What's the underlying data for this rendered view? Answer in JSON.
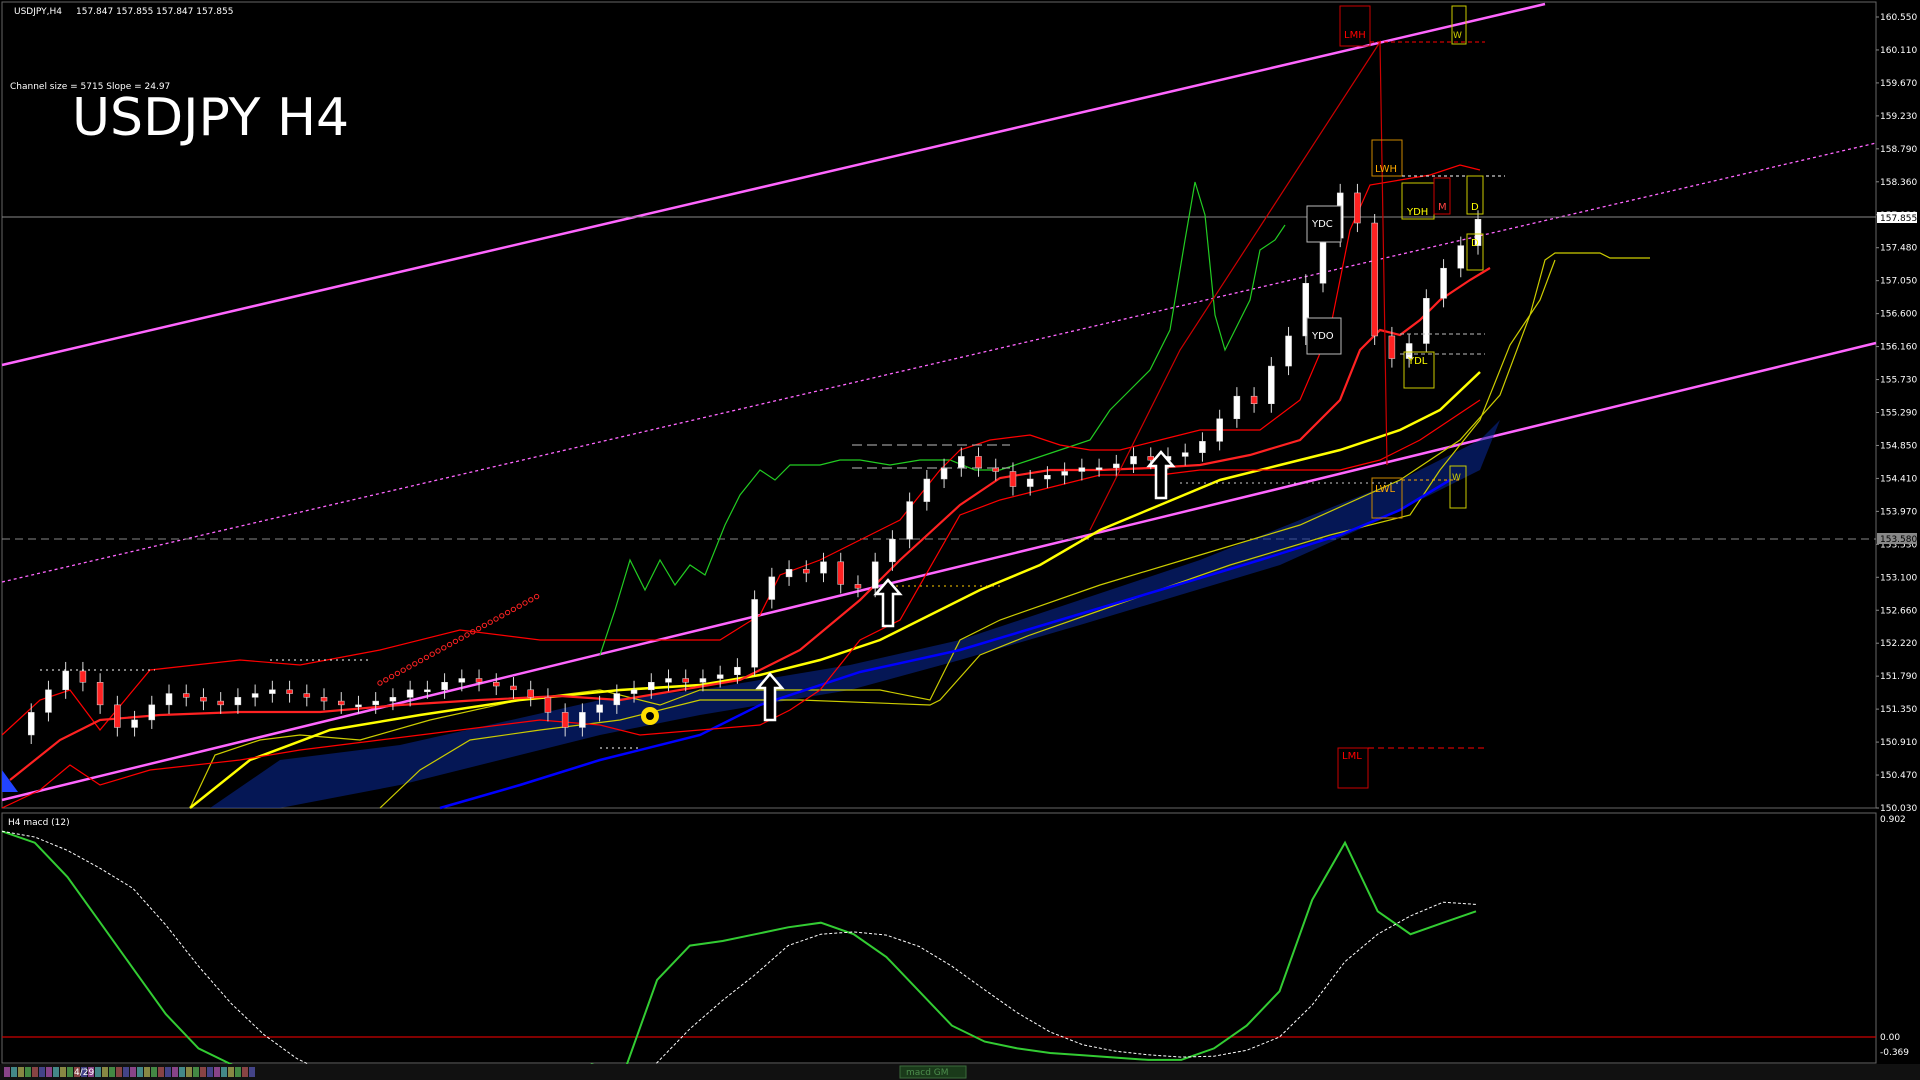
{
  "header": {
    "symbol_info": "USDJPY,H4",
    "ohlc": "157.847 157.855 157.847 157.855"
  },
  "overlay": {
    "channel_info": "Channel size = 5715 Slope = 24.97",
    "big_title": "USDJPY H4"
  },
  "subwindow": {
    "label": "H4 macd (12)"
  },
  "bottom_bar": {
    "date_label": "4/29",
    "tab_label": "macd GM"
  },
  "level_labels": {
    "lmh": "LMH",
    "lml": "LML",
    "lwh": "LWH",
    "lwl": "LWL",
    "ydh": "YDH",
    "ydl": "YDL",
    "ydc": "YDC",
    "ydo": "YDO",
    "w_top": "W",
    "w_bottom": "W",
    "d_top": "D",
    "d_mid": "D",
    "m": "M"
  },
  "colors": {
    "background": "#000000",
    "channel": "#ff66ff",
    "ma_yellow": "#ffff00",
    "ma_blue": "#0000ff",
    "bollinger": "#ff0000",
    "ichimoku_lead": "#00ff00",
    "ichimoku_span": "#cccc00",
    "macd": "#33cc33",
    "signal": "#ffffff",
    "price_line_label": "#ffffff"
  },
  "chart_data": {
    "type": "line",
    "title": "USDJPY H4",
    "price_axis": [
      "160.550",
      "160.110",
      "159.670",
      "159.230",
      "158.790",
      "158.360",
      "157.920",
      "157.480",
      "157.050",
      "156.600",
      "156.160",
      "155.730",
      "155.290",
      "154.850",
      "154.410",
      "153.970",
      "153.530",
      "153.100",
      "152.660",
      "152.220",
      "151.790",
      "151.350",
      "150.910",
      "150.470",
      "150.030"
    ],
    "current_price": "157.855",
    "marked_level": "153.580",
    "macd_axis": [
      "0.902",
      "0.00",
      "-0.369"
    ],
    "macd_zero_label": "0.00",
    "ylim": [
      150.03,
      160.55
    ],
    "close_path": [
      151.0,
      151.3,
      151.6,
      151.85,
      151.7,
      151.4,
      151.1,
      151.2,
      151.4,
      151.55,
      151.5,
      151.45,
      151.4,
      151.5,
      151.55,
      151.6,
      151.55,
      151.5,
      151.45,
      151.4,
      151.4,
      151.45,
      151.5,
      151.6,
      151.6,
      151.7,
      151.75,
      151.7,
      151.65,
      151.6,
      151.5,
      151.3,
      151.1,
      151.3,
      151.4,
      151.55,
      151.6,
      151.7,
      151.75,
      151.7,
      151.75,
      151.8,
      151.9,
      152.8,
      153.1,
      153.2,
      153.15,
      153.3,
      153.0,
      152.95,
      153.3,
      153.6,
      154.1,
      154.4,
      154.55,
      154.7,
      154.55,
      154.5,
      154.3,
      154.4,
      154.45,
      154.5,
      154.55,
      154.55,
      154.6,
      154.7,
      154.65,
      154.7,
      154.75,
      154.9,
      155.2,
      155.5,
      155.4,
      155.9,
      156.3,
      157.0,
      157.6,
      158.2,
      157.8,
      156.3,
      156.0,
      156.2,
      156.8,
      157.2,
      157.5,
      157.85
    ],
    "macd_values": [
      0.9,
      0.85,
      0.7,
      0.5,
      0.3,
      0.1,
      -0.05,
      -0.12,
      -0.18,
      -0.22,
      -0.25,
      -0.26,
      -0.24,
      -0.23,
      -0.24,
      -0.27,
      -0.34,
      -0.2,
      -0.12,
      -0.15,
      0.25,
      0.4,
      0.42,
      0.45,
      0.48,
      0.5,
      0.45,
      0.35,
      0.2,
      0.05,
      -0.02,
      -0.05,
      -0.07,
      -0.08,
      -0.09,
      -0.1,
      -0.1,
      -0.05,
      0.05,
      0.2,
      0.6,
      0.85,
      0.55,
      0.45,
      0.5,
      0.55
    ]
  }
}
